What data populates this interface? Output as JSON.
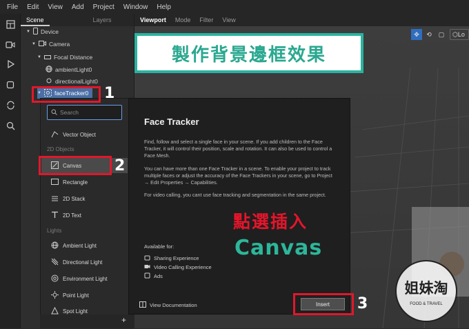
{
  "menu": [
    "File",
    "Edit",
    "View",
    "Add",
    "Project",
    "Window",
    "Help"
  ],
  "scene_panel": {
    "tab_scene": "Scene",
    "tab_layers": "Layers",
    "tree": [
      "Device",
      "Camera",
      "Focal Distance",
      "ambientLight0",
      "directionalLight0",
      "faceTracker0"
    ]
  },
  "viewport_header": {
    "tabs": [
      "Viewport",
      "Mode",
      "Filter",
      "View"
    ],
    "right_label": "Lo"
  },
  "banner": "製作背景邊框效果",
  "dropdown": {
    "search_placeholder": "Search",
    "items": {
      "vector_object": "Vector Object",
      "sect_2d": "2D Objects",
      "canvas": "Canvas",
      "rectangle": "Rectangle",
      "stack": "2D Stack",
      "text": "2D Text",
      "sect_lights": "Lights",
      "ambient": "Ambient Light",
      "directional": "Directional Light",
      "environment": "Environment Light",
      "point": "Point Light",
      "spot": "Spot Light"
    },
    "add_symbol": "+"
  },
  "info": {
    "title": "Face Tracker",
    "p1": "Find, follow and select a single face in your scene. If you add children to the Face Tracker, it will control their position, scale and rotation. It can also be used to control a Face Mesh.",
    "p2": "You can have more than one Face Tracker in a scene. To enable your project to track multiple faces or adjust the accuracy of the Face Trackers in your scene, go to Project → Edit Properties → Capabilities.",
    "p3": "For video calling, you cant use face tracking and segmentation in the same project.",
    "available_for": "Available for:",
    "avail": [
      "Sharing Experience",
      "Video Calling Experience",
      "Ads"
    ],
    "view_docs": "View Documentation",
    "insert": "Insert"
  },
  "annotations": {
    "step1": "1",
    "step2": "2",
    "step3": "3",
    "red_text": "點選插入",
    "teal_text": "Canvas"
  },
  "watermark": {
    "logo_text": "姐妹淘",
    "caption": "FOOD & TRAVEL"
  },
  "colors": {
    "accent_red": "#e0182b",
    "teal": "#2db69a",
    "select_blue": "#4a6fa5"
  }
}
